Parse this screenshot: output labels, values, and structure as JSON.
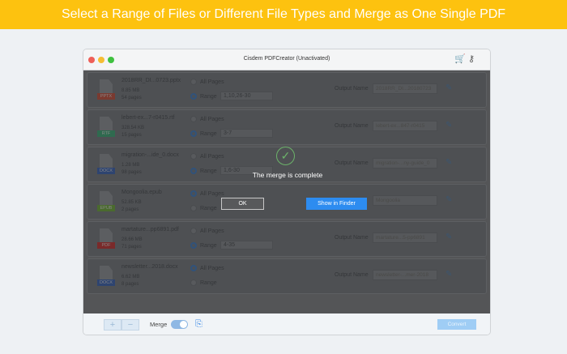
{
  "banner": "Select a Range of Files or Different File Types and Merge as One Single PDF",
  "window": {
    "title": "Cisdem PDFCreator (Unactivated)"
  },
  "labels": {
    "all_pages": "All Pages",
    "range": "Range",
    "output_name": "Output Name"
  },
  "files": [
    {
      "name": "2018RR_DI...0723.pptx",
      "size": "8.85 MB",
      "pages": "54 pages",
      "type": "PPTX",
      "type_color": "#7a3a30",
      "mode": "range",
      "range": "1,10,26-30",
      "output": "2018RR_DI...20180723"
    },
    {
      "name": "lebert-ex...7-r0415.rtf",
      "size": "328.54 KB",
      "pages": "15 pages",
      "type": "RTF",
      "type_color": "#2f6a4f",
      "mode": "range",
      "range": "3-7",
      "output": "lebert-ex...847-r0415"
    },
    {
      "name": "migration-...ide_0.docx",
      "size": "1.28 MB",
      "pages": "98 pages",
      "type": "DOCX",
      "type_color": "#2e4470",
      "mode": "range",
      "range": "1,6-30",
      "output": "migration-...ny-guide_0"
    },
    {
      "name": "Mongoolia.epub",
      "size": "52.85 KB",
      "pages": "2 pages",
      "type": "EPUB",
      "type_color": "#4a6a2e",
      "mode": "all",
      "range": "",
      "output": "Mongoolia"
    },
    {
      "name": "martature...pp6891.pdf",
      "size": "28.66 MB",
      "pages": "71 pages",
      "type": "PDF",
      "type_color": "#7a2a2a",
      "mode": "range",
      "range": "4-35",
      "output": "martature...5-pp6891"
    },
    {
      "name": "newsletter...2018.docx",
      "size": "6.62 MB",
      "pages": "8 pages",
      "type": "DOCX",
      "type_color": "#2e4470",
      "mode": "all",
      "range": "",
      "output": "newsletter-...mer-2018"
    }
  ],
  "bottom": {
    "add": "+",
    "remove": "−",
    "merge_label": "Merge",
    "merge_on": true,
    "convert": "Convert"
  },
  "dialog": {
    "message": "The merge is complete",
    "ok": "OK",
    "show_in_finder": "Show in Finder"
  }
}
